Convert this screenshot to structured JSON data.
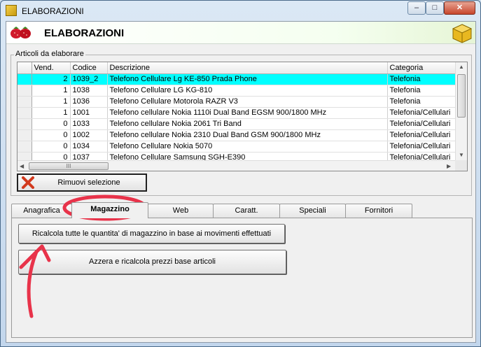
{
  "window": {
    "title": "ELABORAZIONI",
    "minimize_glyph": "–",
    "maximize_glyph": "□",
    "close_glyph": "✕"
  },
  "header": {
    "title": "ELABORAZIONI",
    "left_icon": "strawberry-icon",
    "right_icon": "box-icon"
  },
  "group": {
    "label": "Articoli da elaborare"
  },
  "grid": {
    "columns": [
      "Vend.",
      "Codice",
      "Descrizione",
      "Categoria"
    ],
    "rows": [
      {
        "vend": "2",
        "codice": "1039_2",
        "descrizione": "Telefono Cellulare Lg KE-850 Prada Phone",
        "categoria": "Telefonia",
        "selected": true
      },
      {
        "vend": "1",
        "codice": "1038",
        "descrizione": "Telefono Cellulare LG KG-810",
        "categoria": "Telefonia"
      },
      {
        "vend": "1",
        "codice": "1036",
        "descrizione": "Telefono Cellulare Motorola RAZR V3",
        "categoria": "Telefonia"
      },
      {
        "vend": "1",
        "codice": "1001",
        "descrizione": "Telefono cellulare Nokia 1110i Dual Band EGSM 900/1800 MHz",
        "categoria": "Telefonia/Cellulari"
      },
      {
        "vend": "0",
        "codice": "1033",
        "descrizione": "Telefono cellulare Nokia 2061 Tri Band",
        "categoria": "Telefonia/Cellulari"
      },
      {
        "vend": "0",
        "codice": "1002",
        "descrizione": "Telefono cellulare Nokia 2310 Dual Band GSM 900/1800 MHz",
        "categoria": "Telefonia/Cellulari"
      },
      {
        "vend": "0",
        "codice": "1034",
        "descrizione": "Telefono Cellulare Nokia 5070",
        "categoria": "Telefonia/Cellulari"
      },
      {
        "vend": "0",
        "codice": "1037",
        "descrizione": "Telefono Cellulare Samsung SGH-E390",
        "categoria": "Telefonia/Cellulari"
      }
    ],
    "hscroll_thumb": "III"
  },
  "remove_button": {
    "label": "Rimuovi selezione"
  },
  "tabs": [
    {
      "label": "Anagrafica",
      "active": false
    },
    {
      "label": "Magazzino",
      "active": true
    },
    {
      "label": "Web",
      "active": false
    },
    {
      "label": "Caratt.",
      "active": false
    },
    {
      "label": "Speciali",
      "active": false
    },
    {
      "label": "Fornitori",
      "active": false
    }
  ],
  "actions": {
    "recalc_label": "Ricalcola tutte le quantita' di magazzino in base ai movimenti effettuati",
    "reset_label": "Azzera e ricalcola prezzi base articoli"
  },
  "colors": {
    "selection": "#00ffff",
    "annotation": "#e8334a"
  }
}
